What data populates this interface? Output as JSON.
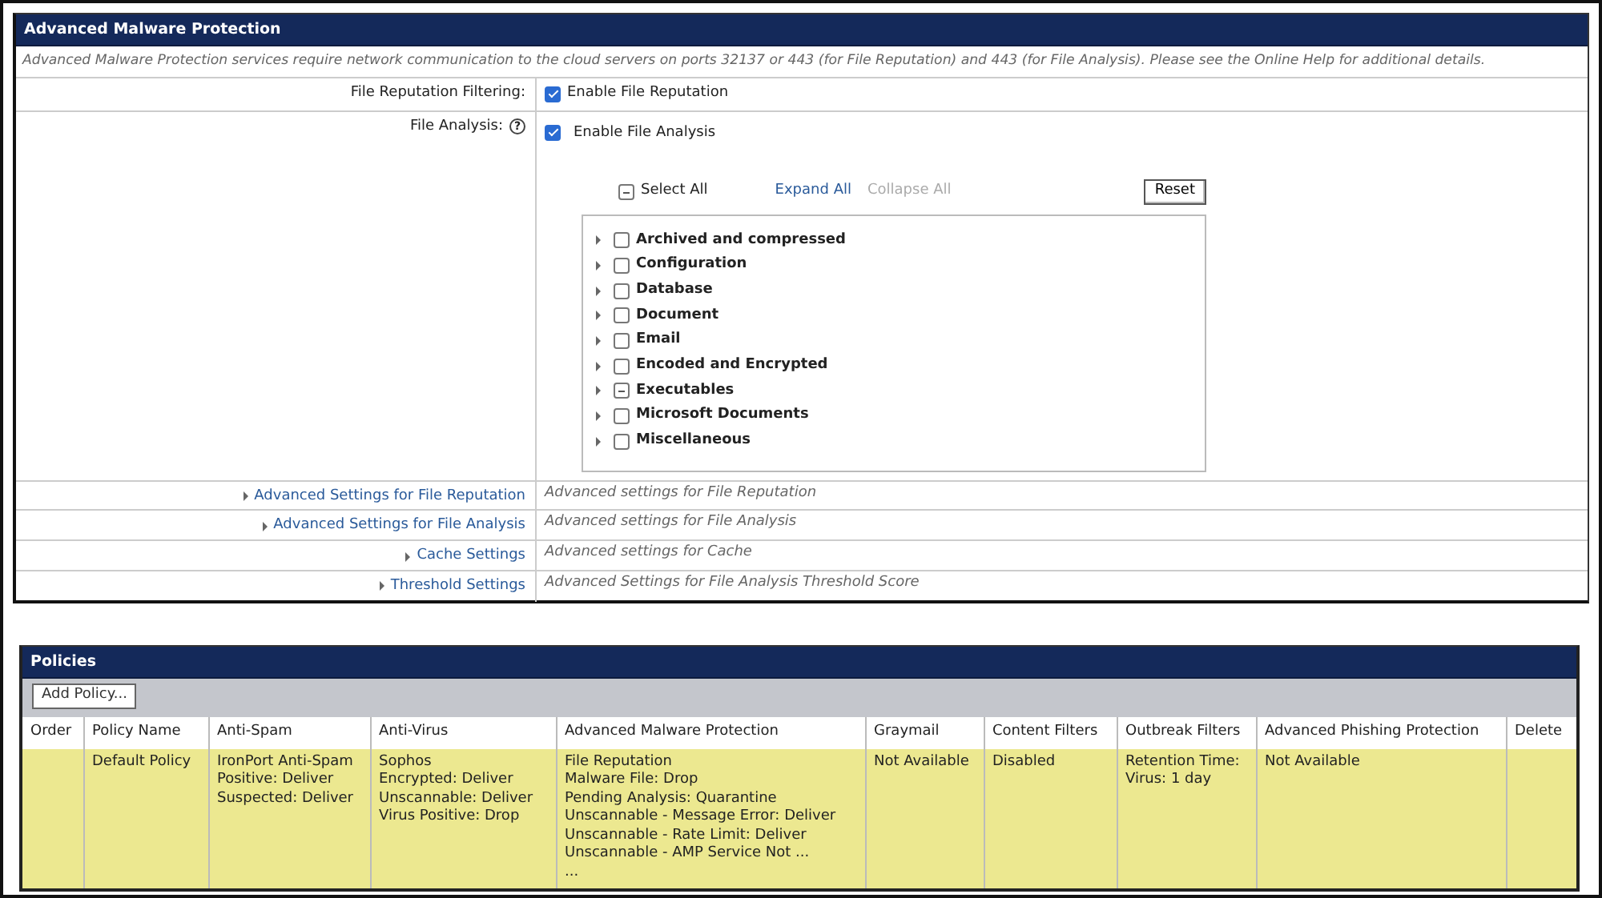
{
  "amp_panel": {
    "title": "Advanced Malware Protection",
    "description": "Advanced Malware Protection services require network communication to the cloud servers on ports 32137 or 443 (for File Reputation) and 443 (for File Analysis). Please see the Online Help for additional details.",
    "file_reputation": {
      "label": "File Reputation Filtering:",
      "checkbox": {
        "label": "Enable File Reputation",
        "checked": true
      }
    },
    "file_analysis": {
      "label": "File Analysis:",
      "help": "?",
      "checkbox": {
        "label": "Enable File Analysis",
        "checked": true
      },
      "select_all": {
        "label": "Select All",
        "indeterminate": true
      },
      "expand_all": {
        "label": "Expand All",
        "disabled": false
      },
      "collapse_all": {
        "label": "Collapse All",
        "disabled": true
      },
      "reset": "Reset",
      "tree": [
        {
          "label": "Archived and compressed",
          "indeterminate": false,
          "expanded": false
        },
        {
          "label": "Configuration",
          "indeterminate": false,
          "expanded": false
        },
        {
          "label": "Database",
          "indeterminate": false,
          "expanded": false
        },
        {
          "label": "Document",
          "indeterminate": false,
          "expanded": false
        },
        {
          "label": "Email",
          "indeterminate": false,
          "expanded": false
        },
        {
          "label": "Encoded and Encrypted",
          "indeterminate": false,
          "expanded": false
        },
        {
          "label": "Executables",
          "indeterminate": true,
          "expanded": false
        },
        {
          "label": "Microsoft Documents",
          "indeterminate": false,
          "expanded": false
        },
        {
          "label": "Miscellaneous",
          "indeterminate": false,
          "expanded": false
        }
      ]
    },
    "advanced_rows": [
      {
        "label": "Advanced Settings for File Reputation",
        "expanded": false,
        "summary": "Advanced settings for File Reputation"
      },
      {
        "label": "Advanced Settings for File Analysis",
        "expanded": false,
        "summary": "Advanced settings for File Analysis"
      },
      {
        "label": "Cache Settings",
        "expanded": false,
        "summary": "Advanced settings for Cache"
      },
      {
        "label": "Threshold Settings",
        "expanded": false,
        "summary": "Advanced Settings for File Analysis Threshold Score"
      }
    ]
  },
  "policies_panel": {
    "title": "Policies",
    "add_button": "Add Policy...",
    "table": {
      "columns": [
        "Order",
        "Policy Name",
        "Anti-Spam",
        "Anti-Virus",
        "Advanced Malware Protection",
        "Graymail",
        "Content Filters",
        "Outbreak Filters",
        "Advanced Phishing Protection",
        "Delete"
      ],
      "rows": [
        {
          "cells": [
            [],
            [
              "Default Policy"
            ],
            [
              "IronPort Anti-Spam",
              "Positive: Deliver",
              "Suspected: Deliver"
            ],
            [
              "Sophos",
              "Encrypted: Deliver",
              "Unscannable: Deliver",
              "Virus Positive: Drop"
            ],
            [
              "File Reputation",
              "Malware File: Drop",
              "Pending Analysis: Quarantine",
              "Unscannable - Message Error: Deliver",
              "Unscannable - Rate Limit: Deliver",
              "Unscannable - AMP Service Not ...",
              "..."
            ],
            [
              "Not Available"
            ],
            [
              "Disabled"
            ],
            [
              "Retention Time:",
              "Virus: 1 day"
            ],
            [
              "Not Available"
            ],
            []
          ]
        }
      ]
    }
  }
}
